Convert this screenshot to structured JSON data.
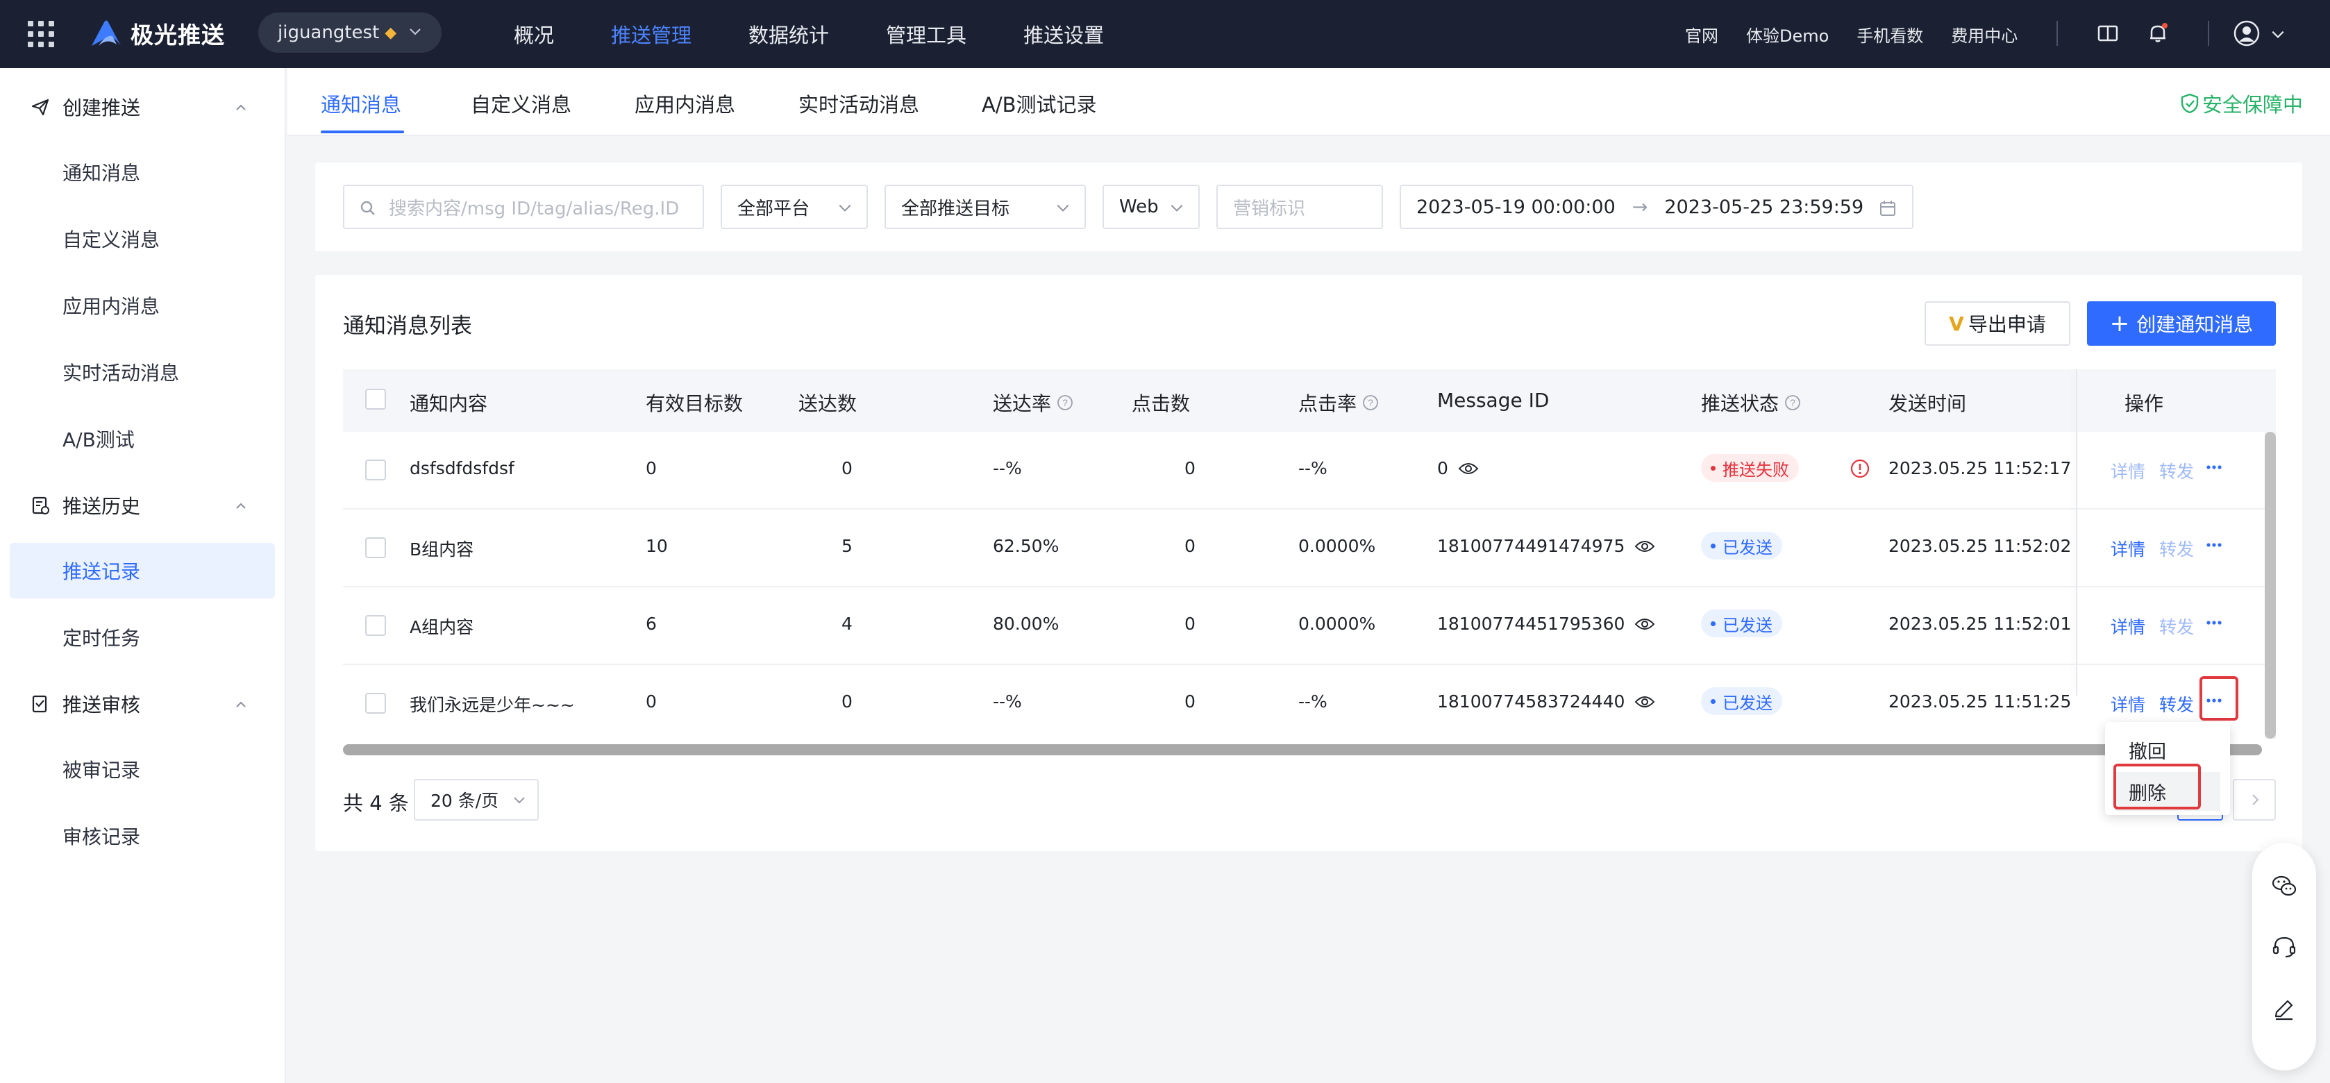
{
  "brand": {
    "name": "极光推送"
  },
  "app_selector": {
    "value": "jiguangtest"
  },
  "main_nav": [
    {
      "label": "概况",
      "active": false
    },
    {
      "label": "推送管理",
      "active": true
    },
    {
      "label": "数据统计",
      "active": false
    },
    {
      "label": "管理工具",
      "active": false
    },
    {
      "label": "推送设置",
      "active": false
    }
  ],
  "top_links": [
    "官网",
    "体验Demo",
    "手机看数",
    "费用中心"
  ],
  "sidebar": {
    "groups": [
      {
        "label": "创建推送",
        "items": [
          "通知消息",
          "自定义消息",
          "应用内消息",
          "实时活动消息",
          "A/B测试"
        ]
      },
      {
        "label": "推送历史",
        "items": [
          "推送记录",
          "定时任务"
        ]
      },
      {
        "label": "推送审核",
        "items": [
          "被审记录",
          "审核记录"
        ]
      }
    ],
    "active_item": "推送记录"
  },
  "tabs": [
    "通知消息",
    "自定义消息",
    "应用内消息",
    "实时活动消息",
    "A/B测试记录"
  ],
  "safety_label": "安全保障中",
  "filters": {
    "search_placeholder": "搜索内容/msg ID/tag/alias/Reg.ID",
    "platform": "全部平台",
    "target": "全部推送目标",
    "channel": "Web",
    "marketing_placeholder": "营销标识",
    "date_start": "2023-05-19 00:00:00",
    "date_arrow": "→",
    "date_end": "2023-05-25 23:59:59"
  },
  "list": {
    "title": "通知消息列表",
    "export_label": "导出申请",
    "export_mark": "V",
    "create_label": "创建通知消息",
    "columns": [
      "通知内容",
      "有效目标数",
      "送达数",
      "送达率",
      "点击数",
      "点击率",
      "Message ID",
      "推送状态",
      "发送时间",
      "操作"
    ],
    "rows": [
      {
        "content": "dsfsdfdsfdsf",
        "targets": "0",
        "delivered": "0",
        "rate": "--%",
        "clicks": "0",
        "click_rate": "--%",
        "msg_id": "0",
        "status": "推送失败",
        "status_type": "fail",
        "time": "2023.05.25 11:52:17",
        "detail": "详情",
        "forward": "转发"
      },
      {
        "content": "B组内容",
        "targets": "10",
        "delivered": "5",
        "rate": "62.50%",
        "clicks": "0",
        "click_rate": "0.0000%",
        "msg_id": "18100774491474975",
        "status": "已发送",
        "status_type": "ok",
        "time": "2023.05.25 11:52:02",
        "detail": "详情",
        "forward": "转发"
      },
      {
        "content": "A组内容",
        "targets": "6",
        "delivered": "4",
        "rate": "80.00%",
        "clicks": "0",
        "click_rate": "0.0000%",
        "msg_id": "18100774451795360",
        "status": "已发送",
        "status_type": "ok",
        "time": "2023.05.25 11:52:01",
        "detail": "详情",
        "forward": "转发"
      },
      {
        "content": "我们永远是少年~~~",
        "targets": "0",
        "delivered": "0",
        "rate": "--%",
        "clicks": "0",
        "click_rate": "--%",
        "msg_id": "18100774583724440",
        "status": "已发送",
        "status_type": "ok",
        "time": "2023.05.25 11:51:25",
        "detail": "详情",
        "forward": "转发"
      }
    ],
    "total_label": "共 4 条",
    "page_size": "20 条/页"
  },
  "row_menu": {
    "items": [
      "撤回",
      "删除"
    ],
    "highlighted": "删除"
  },
  "colors": {
    "accent": "#2f6bff",
    "topbar": "#1b2133",
    "success": "#27b368",
    "danger": "#e3343f"
  }
}
